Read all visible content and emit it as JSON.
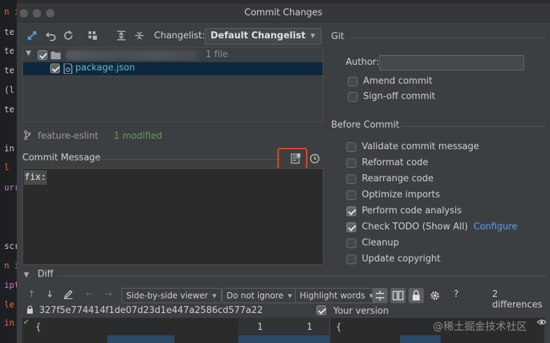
{
  "window": {
    "title": "Commit Changes"
  },
  "editor_strip": {
    "fragments": [
      "n i",
      "te",
      "te",
      "te",
      "(l",
      "te",
      "in",
      "l ",
      "urr",
      "scr",
      "n i",
      "ipt",
      "le",
      "in"
    ]
  },
  "toolbar": {
    "changelist_label": "Changelist:",
    "changelist_value": "Default Changelist",
    "icons": [
      "diff-icon",
      "undo-icon",
      "refresh-icon",
      "group-icon",
      "expand-all-icon",
      "collapse-all-icon"
    ]
  },
  "files": {
    "root_count": "1 file",
    "items": [
      {
        "name": "package.json",
        "checked": true
      }
    ]
  },
  "branch": {
    "name": "feature-eslint",
    "status": "1 modified"
  },
  "commit_message": {
    "label": "Commit Message",
    "text": "fix:"
  },
  "git": {
    "header": "Git",
    "author_label": "Author:",
    "author_value": "",
    "options": [
      {
        "label": "Amend commit",
        "checked": false
      },
      {
        "label": "Sign-off commit",
        "checked": false
      }
    ]
  },
  "before_commit": {
    "header": "Before Commit",
    "options": [
      {
        "label": "Validate commit message",
        "checked": false
      },
      {
        "label": "Reformat code",
        "checked": false
      },
      {
        "label": "Rearrange code",
        "checked": false
      },
      {
        "label": "Optimize imports",
        "checked": false
      },
      {
        "label": "Perform code analysis",
        "checked": true
      },
      {
        "label": "Check TODO (Show All)",
        "checked": true,
        "link": "Configure"
      },
      {
        "label": "Cleanup",
        "checked": false
      },
      {
        "label": "Update copyright",
        "checked": false
      }
    ]
  },
  "diff": {
    "header": "Diff",
    "viewer": "Side-by-side viewer",
    "ignore": "Do not ignore",
    "highlight": "Highlight words",
    "differences": "2 differences",
    "help": "?",
    "commit_hash": "327f5e774414f1de07d23d1e447a2586cd577a22",
    "your_version": "Your version",
    "your_version_checked": true,
    "left_line": "{",
    "right_line": "{",
    "left_num": "1",
    "right_num": "1"
  },
  "watermark": "@稀土掘金技术社区",
  "colors": {
    "accent_link": "#589df6",
    "selection": "#0d293e",
    "highlight_box": "#e0482c",
    "file_name": "#6fb3d2",
    "branch_status": "#6a9955"
  }
}
